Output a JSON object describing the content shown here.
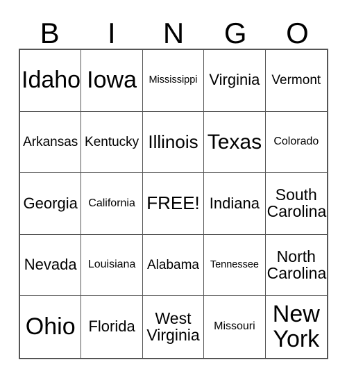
{
  "card": {
    "header_letters": [
      "B",
      "I",
      "N",
      "G",
      "O"
    ],
    "free_space_label": "FREE!",
    "rows": [
      [
        {
          "label": "Idaho",
          "size": "fs-xxl"
        },
        {
          "label": "Iowa",
          "size": "fs-xxl"
        },
        {
          "label": "Mississippi",
          "size": "fs-xxs"
        },
        {
          "label": "Virginia",
          "size": "fs-md"
        },
        {
          "label": "Vermont",
          "size": "fs-sm"
        }
      ],
      [
        {
          "label": "Arkansas",
          "size": "fs-sm"
        },
        {
          "label": "Kentucky",
          "size": "fs-sm"
        },
        {
          "label": "Illinois",
          "size": "fs-lg"
        },
        {
          "label": "Texas",
          "size": "fs-xl"
        },
        {
          "label": "Colorado",
          "size": "fs-xs"
        }
      ],
      [
        {
          "label": "Georgia",
          "size": "fs-md"
        },
        {
          "label": "California",
          "size": "fs-xs"
        },
        {
          "label": "FREE!",
          "size": "fs-lg"
        },
        {
          "label": "Indiana",
          "size": "fs-md"
        },
        {
          "label": "South\nCarolina",
          "size": "fs-two-lg"
        }
      ],
      [
        {
          "label": "Nevada",
          "size": "fs-md"
        },
        {
          "label": "Louisiana",
          "size": "fs-xs"
        },
        {
          "label": "Alabama",
          "size": "fs-sm"
        },
        {
          "label": "Tennessee",
          "size": "fs-xxs"
        },
        {
          "label": "North\nCarolina",
          "size": "fs-two-lg"
        }
      ],
      [
        {
          "label": "Ohio",
          "size": "fs-xxl"
        },
        {
          "label": "Florida",
          "size": "fs-md"
        },
        {
          "label": "West\nVirginia",
          "size": "fs-two-lg"
        },
        {
          "label": "Missouri",
          "size": "fs-xs"
        },
        {
          "label": "New\nYork",
          "size": "fs-xxl"
        }
      ]
    ]
  }
}
